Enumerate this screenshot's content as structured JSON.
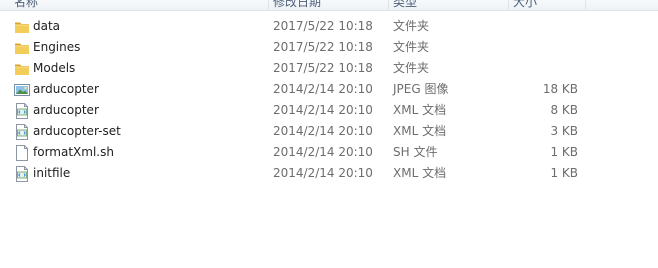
{
  "header": {
    "columns": [
      "名称",
      "修改日期",
      "类型",
      "大小"
    ]
  },
  "files": [
    {
      "name": "data",
      "date": "2017/5/22 10:18",
      "type": "文件夹",
      "size": "",
      "icon": "folder-icon"
    },
    {
      "name": "Engines",
      "date": "2017/5/22 10:18",
      "type": "文件夹",
      "size": "",
      "icon": "folder-icon"
    },
    {
      "name": "Models",
      "date": "2017/5/22 10:18",
      "type": "文件夹",
      "size": "",
      "icon": "folder-icon"
    },
    {
      "name": "arducopter",
      "date": "2014/2/14 20:10",
      "type": "JPEG 图像",
      "size": "18 KB",
      "icon": "image-file-icon"
    },
    {
      "name": "arducopter",
      "date": "2014/2/14 20:10",
      "type": "XML 文档",
      "size": "8 KB",
      "icon": "xml-file-icon"
    },
    {
      "name": "arducopter-set",
      "date": "2014/2/14 20:10",
      "type": "XML 文档",
      "size": "3 KB",
      "icon": "xml-file-icon"
    },
    {
      "name": "formatXml.sh",
      "date": "2014/2/14 20:10",
      "type": "SH 文件",
      "size": "1 KB",
      "icon": "blank-file-icon"
    },
    {
      "name": "initfile",
      "date": "2014/2/14 20:10",
      "type": "XML 文档",
      "size": "1 KB",
      "icon": "xml-file-icon"
    }
  ]
}
